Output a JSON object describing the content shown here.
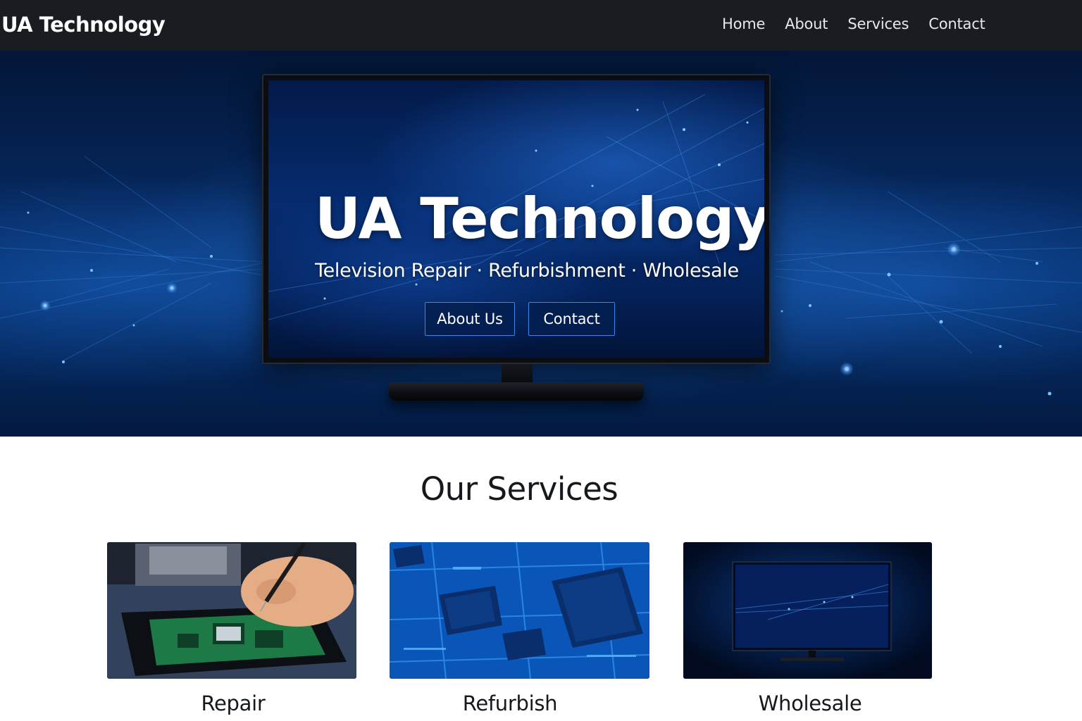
{
  "navbar": {
    "brand": "UA Technology",
    "links": [
      "Home",
      "About",
      "Services",
      "Contact"
    ]
  },
  "hero": {
    "title": "UA Technology",
    "subtitle": "Television Repair · Refurbishment · Wholesale",
    "buttons": {
      "about": "About Us",
      "contact": "Contact"
    }
  },
  "services": {
    "heading": "Our Services",
    "cards": [
      {
        "title": "Repair",
        "image": "technician-repairing-circuit-board"
      },
      {
        "title": "Refurbish",
        "image": "blue-circuit-board-chips"
      },
      {
        "title": "Wholesale",
        "image": "television-on-dark-blue"
      }
    ]
  },
  "colors": {
    "navbar_bg": "#191c21",
    "hero_blue": "#062a63",
    "button_border": "#3b86e8",
    "heading_text": "#15181d"
  }
}
